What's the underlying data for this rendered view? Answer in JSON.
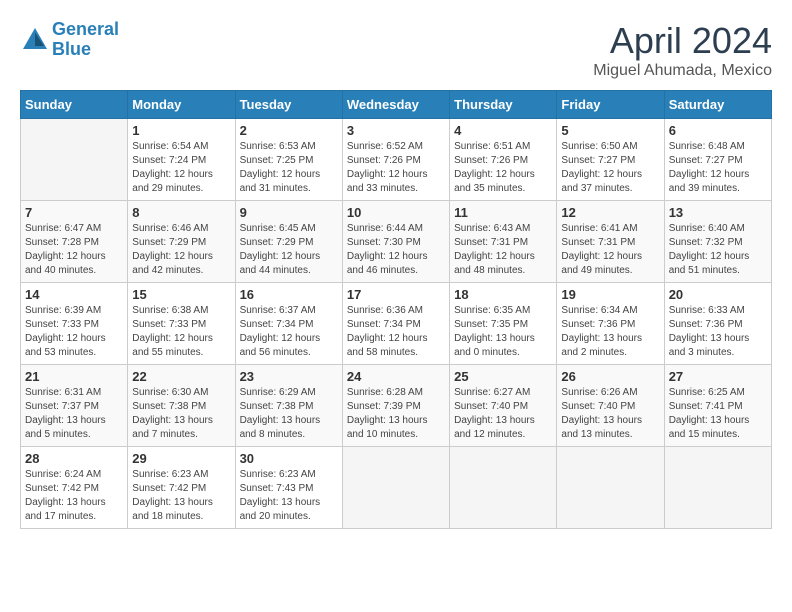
{
  "logo": {
    "line1": "General",
    "line2": "Blue"
  },
  "title": "April 2024",
  "location": "Miguel Ahumada, Mexico",
  "days_of_week": [
    "Sunday",
    "Monday",
    "Tuesday",
    "Wednesday",
    "Thursday",
    "Friday",
    "Saturday"
  ],
  "weeks": [
    [
      {
        "day": "",
        "sunrise": "",
        "sunset": "",
        "daylight": ""
      },
      {
        "day": "1",
        "sunrise": "Sunrise: 6:54 AM",
        "sunset": "Sunset: 7:24 PM",
        "daylight": "Daylight: 12 hours and 29 minutes."
      },
      {
        "day": "2",
        "sunrise": "Sunrise: 6:53 AM",
        "sunset": "Sunset: 7:25 PM",
        "daylight": "Daylight: 12 hours and 31 minutes."
      },
      {
        "day": "3",
        "sunrise": "Sunrise: 6:52 AM",
        "sunset": "Sunset: 7:26 PM",
        "daylight": "Daylight: 12 hours and 33 minutes."
      },
      {
        "day": "4",
        "sunrise": "Sunrise: 6:51 AM",
        "sunset": "Sunset: 7:26 PM",
        "daylight": "Daylight: 12 hours and 35 minutes."
      },
      {
        "day": "5",
        "sunrise": "Sunrise: 6:50 AM",
        "sunset": "Sunset: 7:27 PM",
        "daylight": "Daylight: 12 hours and 37 minutes."
      },
      {
        "day": "6",
        "sunrise": "Sunrise: 6:48 AM",
        "sunset": "Sunset: 7:27 PM",
        "daylight": "Daylight: 12 hours and 39 minutes."
      }
    ],
    [
      {
        "day": "7",
        "sunrise": "Sunrise: 6:47 AM",
        "sunset": "Sunset: 7:28 PM",
        "daylight": "Daylight: 12 hours and 40 minutes."
      },
      {
        "day": "8",
        "sunrise": "Sunrise: 6:46 AM",
        "sunset": "Sunset: 7:29 PM",
        "daylight": "Daylight: 12 hours and 42 minutes."
      },
      {
        "day": "9",
        "sunrise": "Sunrise: 6:45 AM",
        "sunset": "Sunset: 7:29 PM",
        "daylight": "Daylight: 12 hours and 44 minutes."
      },
      {
        "day": "10",
        "sunrise": "Sunrise: 6:44 AM",
        "sunset": "Sunset: 7:30 PM",
        "daylight": "Daylight: 12 hours and 46 minutes."
      },
      {
        "day": "11",
        "sunrise": "Sunrise: 6:43 AM",
        "sunset": "Sunset: 7:31 PM",
        "daylight": "Daylight: 12 hours and 48 minutes."
      },
      {
        "day": "12",
        "sunrise": "Sunrise: 6:41 AM",
        "sunset": "Sunset: 7:31 PM",
        "daylight": "Daylight: 12 hours and 49 minutes."
      },
      {
        "day": "13",
        "sunrise": "Sunrise: 6:40 AM",
        "sunset": "Sunset: 7:32 PM",
        "daylight": "Daylight: 12 hours and 51 minutes."
      }
    ],
    [
      {
        "day": "14",
        "sunrise": "Sunrise: 6:39 AM",
        "sunset": "Sunset: 7:33 PM",
        "daylight": "Daylight: 12 hours and 53 minutes."
      },
      {
        "day": "15",
        "sunrise": "Sunrise: 6:38 AM",
        "sunset": "Sunset: 7:33 PM",
        "daylight": "Daylight: 12 hours and 55 minutes."
      },
      {
        "day": "16",
        "sunrise": "Sunrise: 6:37 AM",
        "sunset": "Sunset: 7:34 PM",
        "daylight": "Daylight: 12 hours and 56 minutes."
      },
      {
        "day": "17",
        "sunrise": "Sunrise: 6:36 AM",
        "sunset": "Sunset: 7:34 PM",
        "daylight": "Daylight: 12 hours and 58 minutes."
      },
      {
        "day": "18",
        "sunrise": "Sunrise: 6:35 AM",
        "sunset": "Sunset: 7:35 PM",
        "daylight": "Daylight: 13 hours and 0 minutes."
      },
      {
        "day": "19",
        "sunrise": "Sunrise: 6:34 AM",
        "sunset": "Sunset: 7:36 PM",
        "daylight": "Daylight: 13 hours and 2 minutes."
      },
      {
        "day": "20",
        "sunrise": "Sunrise: 6:33 AM",
        "sunset": "Sunset: 7:36 PM",
        "daylight": "Daylight: 13 hours and 3 minutes."
      }
    ],
    [
      {
        "day": "21",
        "sunrise": "Sunrise: 6:31 AM",
        "sunset": "Sunset: 7:37 PM",
        "daylight": "Daylight: 13 hours and 5 minutes."
      },
      {
        "day": "22",
        "sunrise": "Sunrise: 6:30 AM",
        "sunset": "Sunset: 7:38 PM",
        "daylight": "Daylight: 13 hours and 7 minutes."
      },
      {
        "day": "23",
        "sunrise": "Sunrise: 6:29 AM",
        "sunset": "Sunset: 7:38 PM",
        "daylight": "Daylight: 13 hours and 8 minutes."
      },
      {
        "day": "24",
        "sunrise": "Sunrise: 6:28 AM",
        "sunset": "Sunset: 7:39 PM",
        "daylight": "Daylight: 13 hours and 10 minutes."
      },
      {
        "day": "25",
        "sunrise": "Sunrise: 6:27 AM",
        "sunset": "Sunset: 7:40 PM",
        "daylight": "Daylight: 13 hours and 12 minutes."
      },
      {
        "day": "26",
        "sunrise": "Sunrise: 6:26 AM",
        "sunset": "Sunset: 7:40 PM",
        "daylight": "Daylight: 13 hours and 13 minutes."
      },
      {
        "day": "27",
        "sunrise": "Sunrise: 6:25 AM",
        "sunset": "Sunset: 7:41 PM",
        "daylight": "Daylight: 13 hours and 15 minutes."
      }
    ],
    [
      {
        "day": "28",
        "sunrise": "Sunrise: 6:24 AM",
        "sunset": "Sunset: 7:42 PM",
        "daylight": "Daylight: 13 hours and 17 minutes."
      },
      {
        "day": "29",
        "sunrise": "Sunrise: 6:23 AM",
        "sunset": "Sunset: 7:42 PM",
        "daylight": "Daylight: 13 hours and 18 minutes."
      },
      {
        "day": "30",
        "sunrise": "Sunrise: 6:23 AM",
        "sunset": "Sunset: 7:43 PM",
        "daylight": "Daylight: 13 hours and 20 minutes."
      },
      {
        "day": "",
        "sunrise": "",
        "sunset": "",
        "daylight": ""
      },
      {
        "day": "",
        "sunrise": "",
        "sunset": "",
        "daylight": ""
      },
      {
        "day": "",
        "sunrise": "",
        "sunset": "",
        "daylight": ""
      },
      {
        "day": "",
        "sunrise": "",
        "sunset": "",
        "daylight": ""
      }
    ]
  ]
}
